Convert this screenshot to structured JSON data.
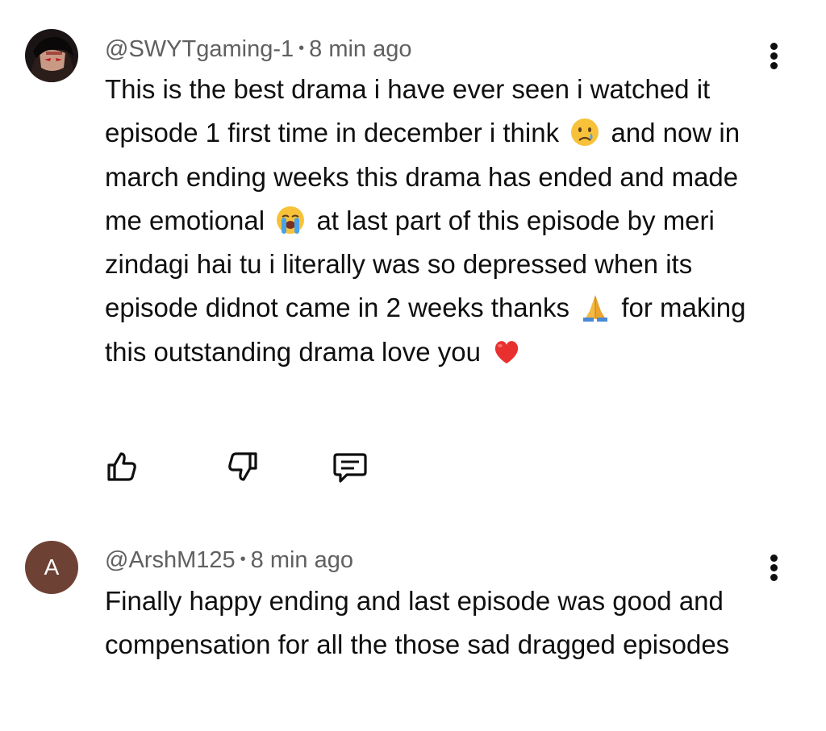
{
  "comments": [
    {
      "handle": "@SWYTgaming-1",
      "time": "8 min ago",
      "text_parts": [
        "This is the best drama i have ever seen i watched it episode 1 first time in december i think",
        "and now in march ending weeks this drama has ended and made me emotional",
        "at last part of this episode by meri  zindagi hai tu i literally was so depressed when its episode didnot came in 2 weeks thanks",
        "for making this outstanding drama love you"
      ],
      "emojis": [
        "crying-face-emoji",
        "loudly-crying-face-emoji",
        "folded-hands-emoji",
        "red-heart-emoji"
      ]
    },
    {
      "handle": "@ArshM125",
      "time": "8 min ago",
      "avatar_letter": "A",
      "avatar_color": "#6d4235",
      "text": "Finally happy ending and last episode was good and compensation for all the those sad dragged episodes"
    }
  ],
  "separator": "•",
  "icons": {
    "like": "thumbs-up-icon",
    "dislike": "thumbs-down-icon",
    "reply": "reply-comment-icon",
    "more": "more-vertical-icon"
  }
}
